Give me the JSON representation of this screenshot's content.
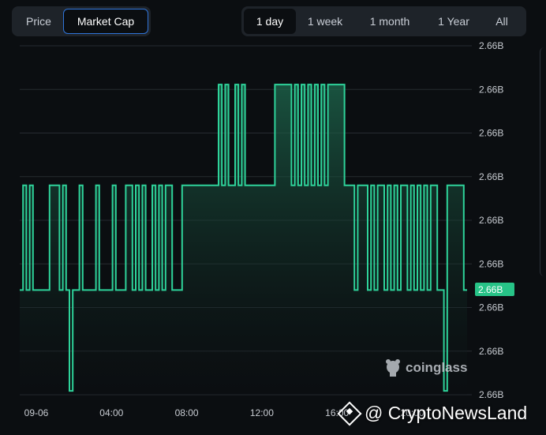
{
  "metric_tabs": [
    {
      "label": "Price",
      "active": false
    },
    {
      "label": "Market Cap",
      "active": true
    }
  ],
  "range_tabs": [
    {
      "label": "1 day",
      "active": true
    },
    {
      "label": "1 week",
      "active": false
    },
    {
      "label": "1 month",
      "active": false
    },
    {
      "label": "1 Year",
      "active": false
    },
    {
      "label": "All",
      "active": false
    }
  ],
  "current_value_label": "2.66B",
  "brand_watermark": "coinglass",
  "news_watermark": "@ CryptoNewsLand",
  "colors": {
    "line": "#2ed39a",
    "badge": "#27c387",
    "active_border": "#2f74d9",
    "background": "#0b0e11"
  },
  "icons": [
    "coinglass-logo-icon",
    "cryptonewsland-logo-icon"
  ],
  "chart_data": {
    "type": "area",
    "title": "",
    "xlabel": "",
    "ylabel": "",
    "x_ticks": [
      "09-06",
      "04:00",
      "08:00",
      "12:00",
      "16:00",
      "20:00"
    ],
    "y_ticks": [
      "2.66B",
      "2.66B",
      "2.66B",
      "2.66B",
      "2.66B",
      "2.66B",
      "2.66B",
      "2.66B",
      "2.66B"
    ],
    "grid": true,
    "ylim": [
      0,
      9
    ],
    "series": [
      {
        "values": [
          2.7,
          5.4,
          2.7,
          5.4,
          2.7,
          2.7,
          2.7,
          2.7,
          2.7,
          5.4,
          5.4,
          5.4,
          2.7,
          5.4,
          2.7,
          0.1,
          2.7,
          2.7,
          5.4,
          2.7,
          2.7,
          2.7,
          2.7,
          5.4,
          2.7,
          2.7,
          2.7,
          2.7,
          5.4,
          2.7,
          2.7,
          2.7,
          5.4,
          5.4,
          2.7,
          5.4,
          2.7,
          5.4,
          2.7,
          2.7,
          5.4,
          2.7,
          5.4,
          2.7,
          5.4,
          5.4,
          2.7,
          2.7,
          2.7,
          5.4,
          5.4,
          5.4,
          5.4,
          5.4,
          5.4,
          5.4,
          5.4,
          5.4,
          5.4,
          5.4,
          8.0,
          5.4,
          8.0,
          5.4,
          5.4,
          8.0,
          5.4,
          8.0,
          5.4,
          5.4,
          5.4,
          5.4,
          5.4,
          5.4,
          5.4,
          5.4,
          5.4,
          8.0,
          8.0,
          8.0,
          8.0,
          8.0,
          5.4,
          8.0,
          5.4,
          8.0,
          5.4,
          8.0,
          5.4,
          8.0,
          5.4,
          8.0,
          5.4,
          8.0,
          8.0,
          8.0,
          8.0,
          8.0,
          5.4,
          5.4,
          5.4,
          2.7,
          5.4,
          5.4,
          5.4,
          2.7,
          5.4,
          2.7,
          5.4,
          5.4,
          2.7,
          5.4,
          2.7,
          5.4,
          2.7,
          5.4,
          5.4,
          2.7,
          5.4,
          2.7,
          5.4,
          2.7,
          5.4,
          2.7,
          5.4,
          5.4,
          2.7,
          2.7,
          0.1,
          5.4,
          5.4,
          5.4,
          5.4,
          5.4,
          2.7
        ]
      }
    ]
  }
}
